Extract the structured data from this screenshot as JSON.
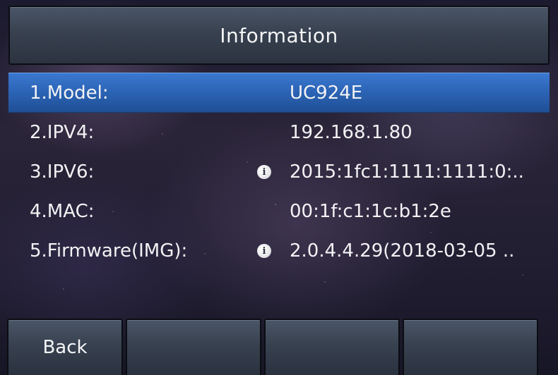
{
  "header": {
    "title": "Information"
  },
  "info_rows": [
    {
      "label": "1.Model:",
      "value": "UC924E",
      "has_info_icon": false,
      "selected": true
    },
    {
      "label": "2.IPV4:",
      "value": "192.168.1.80",
      "has_info_icon": false,
      "selected": false
    },
    {
      "label": "3.IPV6:",
      "value": "2015:1fc1:1111:1111:0:..",
      "has_info_icon": true,
      "selected": false
    },
    {
      "label": "4.MAC:",
      "value": "00:1f:c1:1c:b1:2e",
      "has_info_icon": false,
      "selected": false
    },
    {
      "label": "5.Firmware(IMG):",
      "value": "2.0.4.4.29(2018-03-05 ..",
      "has_info_icon": true,
      "selected": false
    }
  ],
  "softkeys": {
    "key1": "Back",
    "key2": "",
    "key3": "",
    "key4": ""
  },
  "icons": {
    "info": "info-icon",
    "info_glyph": "i"
  },
  "colors": {
    "selection": "#2b63b4",
    "bar": "#38414f",
    "text": "#f2f2f4"
  }
}
